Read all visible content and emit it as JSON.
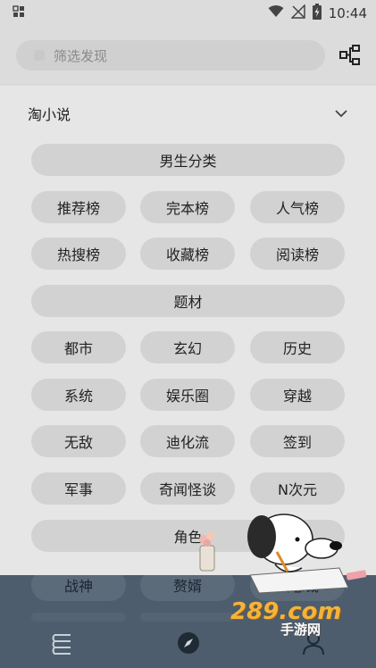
{
  "status_bar": {
    "time": "10:44",
    "icons": [
      "notification-icon",
      "wifi-icon",
      "no-signal-icon",
      "battery-charging-icon"
    ]
  },
  "search": {
    "placeholder": "筛选发现"
  },
  "header": {
    "action_icon": "tree-structure-icon"
  },
  "section": {
    "title": "淘小说",
    "chevron_icon": "chevron-down-icon"
  },
  "groups": [
    {
      "title": "男生分类",
      "items": [
        "推荐榜",
        "完本榜",
        "人气榜",
        "热搜榜",
        "收藏榜",
        "阅读榜"
      ]
    },
    {
      "title": "题材",
      "items": [
        "都市",
        "玄幻",
        "历史",
        "系统",
        "娱乐圈",
        "穿越",
        "无敌",
        "迪化流",
        "签到",
        "军事",
        "奇闻怪谈",
        "N次元"
      ]
    },
    {
      "title": "角色",
      "items": [
        "战神",
        "赘婿",
        "女总裁"
      ]
    }
  ],
  "bottom_nav": {
    "items": [
      {
        "icon": "bookshelf-icon"
      },
      {
        "icon": "compass-icon"
      },
      {
        "icon": "profile-icon"
      }
    ],
    "background": "#4d5d6d"
  },
  "watermark": {
    "text": "289.com",
    "sub": "手游网"
  },
  "colors": {
    "background": "#e6e6e6",
    "chip": "#d2d2d2",
    "nav_bar": "#4d5d6d"
  }
}
